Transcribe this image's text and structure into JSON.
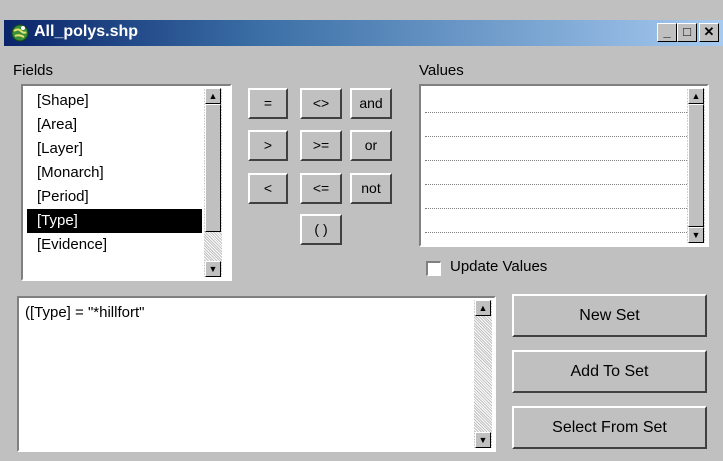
{
  "window": {
    "title": "All_polys.shp",
    "minimize_glyph": "_",
    "maximize_glyph": "□",
    "close_glyph": "✕"
  },
  "fields": {
    "label": "Fields",
    "items": [
      "[Shape]",
      "[Area]",
      "[Layer]",
      "[Monarch]",
      "[Period]",
      "[Type]",
      "[Evidence]"
    ],
    "selected": "[Type]"
  },
  "operators": {
    "eq": "=",
    "ne": "<>",
    "and": "and",
    "gt": ">",
    "ge": ">=",
    "or": "or",
    "lt": "<",
    "le": "<=",
    "not": "not",
    "paren": "( )"
  },
  "values": {
    "label": "Values",
    "items": []
  },
  "update_values": {
    "label": "Update Values",
    "checked": false
  },
  "expression": {
    "text": "([Type] = \"*hillfort\""
  },
  "buttons": {
    "new_set": "New Set",
    "add_to_set": "Add To Set",
    "select_from_set": "Select From Set"
  }
}
